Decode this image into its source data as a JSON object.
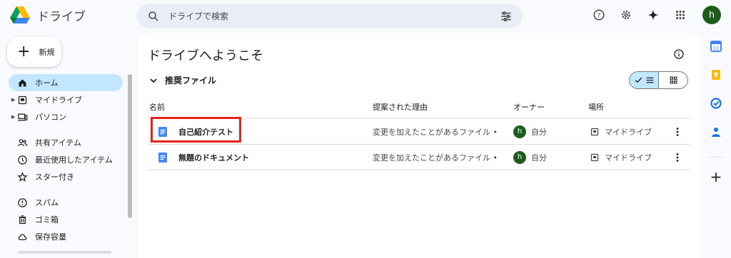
{
  "app": {
    "title": "ドライブ"
  },
  "search": {
    "placeholder": "ドライブで検索"
  },
  "new_button": {
    "label": "新規"
  },
  "user": {
    "initial": "h"
  },
  "sidebar": {
    "items": [
      {
        "label": "ホーム",
        "icon": "home-icon",
        "active": true
      },
      {
        "label": "マイドライブ",
        "icon": "my-drive-icon",
        "expandable": true
      },
      {
        "label": "パソコン",
        "icon": "computer-icon",
        "expandable": true
      },
      {
        "label": "共有アイテム",
        "icon": "shared-icon"
      },
      {
        "label": "最近使用したアイテム",
        "icon": "recent-icon"
      },
      {
        "label": "スター付き",
        "icon": "star-icon"
      },
      {
        "label": "スパム",
        "icon": "spam-icon"
      },
      {
        "label": "ゴミ箱",
        "icon": "trash-icon"
      },
      {
        "label": "保存容量",
        "icon": "cloud-icon"
      }
    ]
  },
  "main": {
    "title": "ドライブへようこそ",
    "section": "推奨ファイル",
    "columns": {
      "name": "名前",
      "reason": "提案された理由",
      "owner": "オーナー",
      "location": "場所"
    },
    "files": [
      {
        "name": "自己紹介テスト",
        "reason": "変更を加えたことがあるファイル •...",
        "owner": "自分",
        "owner_initial": "h",
        "location": "マイドライブ"
      },
      {
        "name": "無題のドキュメント",
        "reason": "変更を加えたことがあるファイル •...",
        "owner": "自分",
        "owner_initial": "h",
        "location": "マイドライブ"
      }
    ]
  },
  "colors": {
    "accent": "#c2e7ff",
    "doc_blue": "#4285f4",
    "highlight": "#e2231a",
    "avatar": "#1e5c1e"
  }
}
